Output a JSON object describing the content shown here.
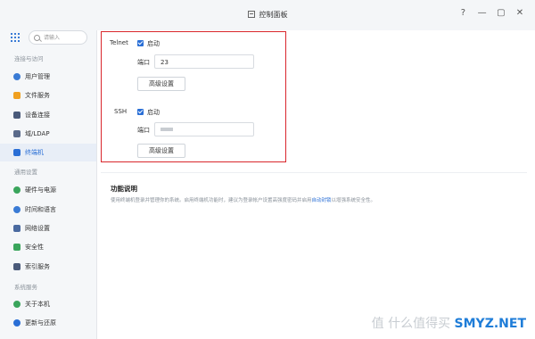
{
  "window": {
    "title": "控制面板",
    "controls": [
      "?",
      "—",
      "▢",
      "✕"
    ]
  },
  "sidebar": {
    "search_placeholder": "请输入",
    "groups": [
      {
        "label": "连接与访问",
        "items": [
          {
            "label": "用户管理",
            "icon": "user-icon",
            "color": "#3a7bd5"
          },
          {
            "label": "文件服务",
            "icon": "folder-icon",
            "color": "#f0a020"
          },
          {
            "label": "设备连接",
            "icon": "device-icon",
            "color": "#4a5a7a"
          },
          {
            "label": "域/LDAP",
            "icon": "domain-icon",
            "color": "#5a6a8a"
          },
          {
            "label": "终端机",
            "icon": "terminal-icon",
            "color": "#2a6fd6",
            "active": true
          }
        ]
      },
      {
        "label": "通用设置",
        "items": [
          {
            "label": "硬件与电源",
            "icon": "power-icon",
            "color": "#3aa55c"
          },
          {
            "label": "时间和语言",
            "icon": "clock-icon",
            "color": "#3a7bd5"
          },
          {
            "label": "网络设置",
            "icon": "network-icon",
            "color": "#4a6aa0"
          },
          {
            "label": "安全性",
            "icon": "shield-icon",
            "color": "#3aa55c"
          },
          {
            "label": "索引服务",
            "icon": "index-icon",
            "color": "#4a5a7a"
          }
        ]
      },
      {
        "label": "系统服务",
        "items": [
          {
            "label": "关于本机",
            "icon": "info-icon",
            "color": "#3aa55c"
          },
          {
            "label": "更新与还原",
            "icon": "update-icon",
            "color": "#2a6fd6"
          }
        ]
      }
    ]
  },
  "main": {
    "telnet": {
      "label": "Telnet",
      "enable_label": "启动",
      "port_label": "端口",
      "port_value": "23",
      "advanced_label": "高级设置"
    },
    "ssh": {
      "label": "SSH",
      "enable_label": "启动",
      "port_label": "端口",
      "advanced_label": "高级设置"
    },
    "function": {
      "title": "功能说明",
      "desc_prefix": "使用终端机登录并管理你的系统。启用终端机功能时，建议为登录帐户设置高强度密码并启用",
      "desc_link": "自动封锁",
      "desc_suffix": "以增强系统安全性。"
    }
  },
  "watermark": {
    "text": "值 什么值得买",
    "brand": "SMYZ.NET"
  }
}
